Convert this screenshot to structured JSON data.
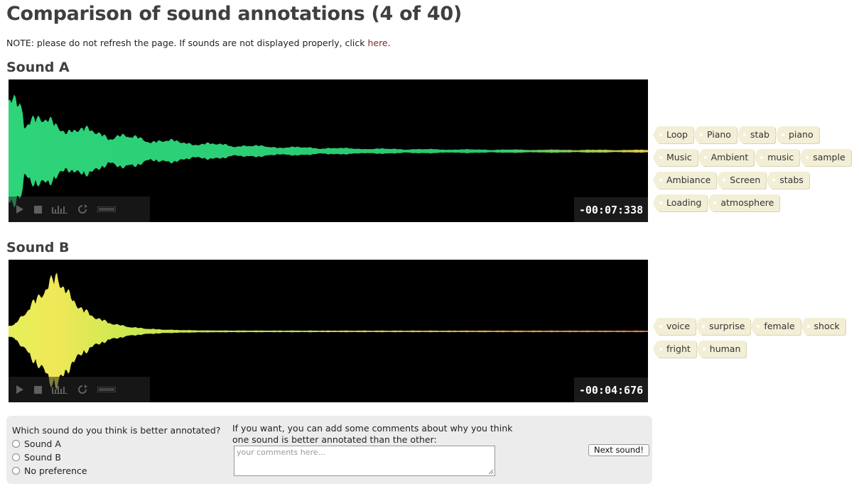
{
  "page": {
    "title": "Comparison of sound annotations (4 of 40)",
    "note_text": "NOTE: please do not refresh the page. If sounds are not displayed properly, click ",
    "note_link": "here",
    "note_end": "."
  },
  "soundA": {
    "heading": "Sound A",
    "time": "-00:07:338",
    "tags": [
      "Loop",
      "Piano",
      "stab",
      "piano",
      "Music",
      "Ambient",
      "music",
      "sample",
      "Ambiance",
      "Screen",
      "stabs",
      "Loading",
      "atmosphere"
    ]
  },
  "soundB": {
    "heading": "Sound B",
    "time": "-00:04:676",
    "tags": [
      "voice",
      "surprise",
      "female",
      "shock",
      "fright",
      "human"
    ]
  },
  "controls": {
    "icons": [
      "play-icon",
      "stop-icon",
      "spectrum-icon",
      "loop-icon",
      "volume-icon"
    ]
  },
  "form": {
    "question": "Which sound do you think is better annotated?",
    "options": [
      "Sound A",
      "Sound B",
      "No preference"
    ],
    "comment_label": "If you want, you can add some comments about why you think one sound is better annotated than the other:",
    "comment_placeholder": "your comments here...",
    "next_label": "Next sound!"
  },
  "colors": {
    "waveA": "#2ed47a",
    "waveB_start": "#d8ec4a",
    "waveB_end": "#e07a3a",
    "tag_bg": "#f2efd6",
    "panel_bg": "#ececec"
  }
}
